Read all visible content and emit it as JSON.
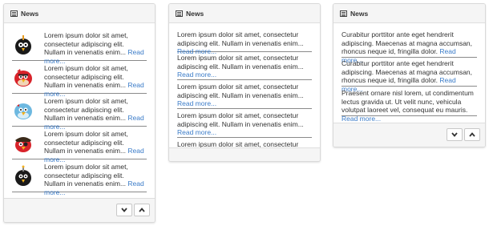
{
  "panels": [
    {
      "title": "News",
      "items": [
        {
          "icon": "black-bird-icon",
          "text": "Lorem ipsum dolor sit amet, consectetur adipiscing elit. Nullam in venenatis enim...",
          "link": "Read more..."
        },
        {
          "icon": "red-bird-icon",
          "text": "Lorem ipsum dolor sit amet, consectetur adipiscing elit. Nullam in venenatis enim...",
          "link": "Read more..."
        },
        {
          "icon": "blue-bird-icon",
          "text": "Lorem ipsum dolor sit amet, consectetur adipiscing elit. Nullam in venenatis enim...",
          "link": "Read more..."
        },
        {
          "icon": "pirate-bird-icon",
          "text": "Lorem ipsum dolor sit amet, consectetur adipiscing elit. Nullam in venenatis enim...",
          "link": "Read more..."
        },
        {
          "icon": "black-bomb-bird-icon",
          "text": "Lorem ipsum dolor sit amet, consectetur adipiscing elit. Nullam in venenatis enim...",
          "link": "Read more..."
        }
      ]
    },
    {
      "title": "News",
      "items": [
        {
          "text": "Lorem ipsum dolor sit amet, consectetur adipiscing elit. Nullam in venenatis enim...",
          "link": "Read more..."
        },
        {
          "text": "Lorem ipsum dolor sit amet, consectetur adipiscing elit. Nullam in venenatis enim...",
          "link": "Read more..."
        },
        {
          "text": "Lorem ipsum dolor sit amet, consectetur adipiscing elit. Nullam in venenatis enim...",
          "link": "Read more..."
        },
        {
          "text": "Lorem ipsum dolor sit amet, consectetur adipiscing elit. Nullam in venenatis enim...",
          "link": "Read more..."
        },
        {
          "text": "Lorem ipsum dolor sit amet, consectetur",
          "link": ""
        }
      ]
    },
    {
      "title": "News",
      "items": [
        {
          "text": "Curabitur porttitor ante eget hendrerit adipiscing. Maecenas at magna accumsan, rhoncus neque id, fringilla dolor.",
          "link": "Read more..."
        },
        {
          "text": "Curabitur porttitor ante eget hendrerit adipiscing. Maecenas at magna accumsan, rhoncus neque id, fringilla dolor.",
          "link": "Read more..."
        },
        {
          "text": "Praesent ornare nisl lorem, ut condimentum lectus gravida ut. Ut velit nunc, vehicula volutpat laoreet vel, consequat eu mauris.",
          "link": "Read more..."
        }
      ]
    }
  ],
  "controls": {
    "down_icon": "chevron-down-icon",
    "up_icon": "chevron-up-icon"
  },
  "colors": {
    "link": "#3a7bc8",
    "panel_header": "#f5f5f5",
    "border": "#d9d9d9"
  }
}
